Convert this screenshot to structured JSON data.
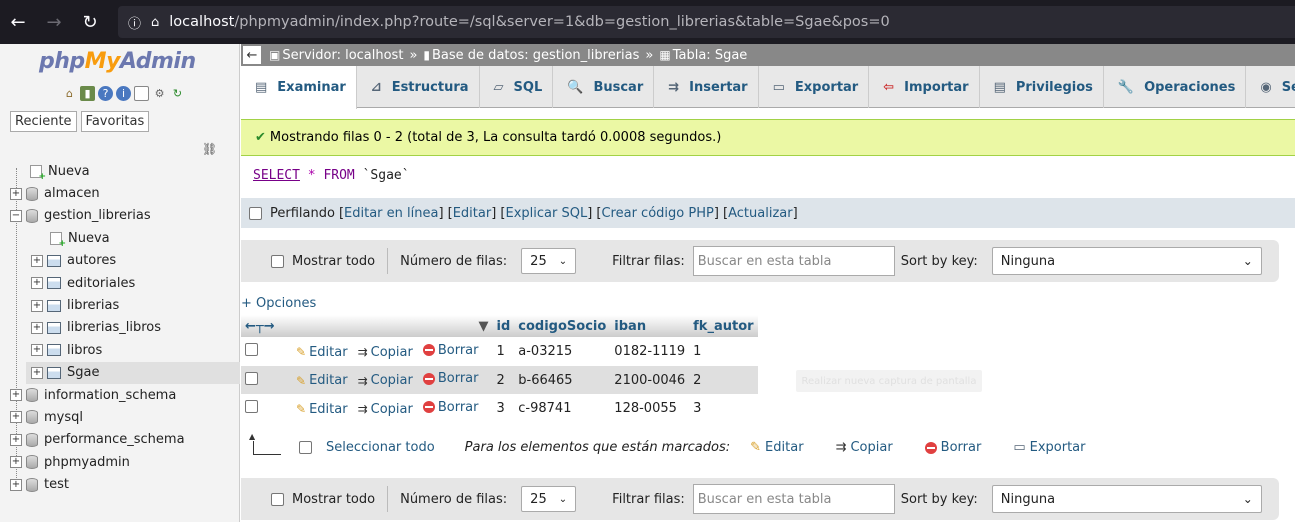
{
  "browser": {
    "url_host": "localhost",
    "url_rest": "/phpmyadmin/index.php?route=/sql&server=1&db=gestion_librerias&table=Sgae&pos=0"
  },
  "sidebar": {
    "logo_php": "php",
    "logo_my": "My",
    "logo_admin": "Admin",
    "tab_recent": "Reciente",
    "tab_favorites": "Favoritas",
    "tree": {
      "new": "Nueva",
      "db_almacen": "almacen",
      "db_gestion": "gestion_librerias",
      "gestion_new": "Nueva",
      "t_autores": "autores",
      "t_editoriales": "editoriales",
      "t_librerias": "librerias",
      "t_librerias_libros": "librerias_libros",
      "t_libros": "libros",
      "t_sgae": "Sgae",
      "db_information": "information_schema",
      "db_mysql": "mysql",
      "db_performance": "performance_schema",
      "db_phpmyadmin": "phpmyadmin",
      "db_test": "test"
    }
  },
  "breadcrumb": {
    "server": "Servidor: localhost",
    "database": "Base de datos: gestion_librerias",
    "table": "Tabla: Sgae"
  },
  "tabs": {
    "browse": "Examinar",
    "structure": "Estructura",
    "sql": "SQL",
    "search": "Buscar",
    "insert": "Insertar",
    "export": "Exportar",
    "import": "Importar",
    "privileges": "Privilegios",
    "operations": "Operaciones",
    "tracking": "Seguimien"
  },
  "message": "Mostrando filas 0 - 2 (total de 3, La consulta tardó 0.0008 segundos.)",
  "query": {
    "select": "SELECT",
    "star": "*",
    "from": "FROM",
    "table": "`Sgae`"
  },
  "profiling": {
    "label": "Perfilando",
    "edit_inline": "Editar en línea",
    "edit": "Editar",
    "explain": "Explicar SQL",
    "php": "Crear código PHP",
    "refresh": "Actualizar"
  },
  "nav": {
    "show_all": "Mostrar todo",
    "rows_label": "Número de filas:",
    "rows_value": "25",
    "filter_label": "Filtrar filas:",
    "filter_placeholder": "Buscar en esta tabla",
    "sort_label": "Sort by key:",
    "sort_value": "Ninguna"
  },
  "options_link": "+ Opciones",
  "table": {
    "columns": [
      "id",
      "codigoSocio",
      "iban",
      "fk_autor"
    ],
    "action_edit": "Editar",
    "action_copy": "Copiar",
    "action_delete": "Borrar",
    "rows": [
      {
        "id": "1",
        "codigoSocio": "a-03215",
        "iban": "0182-1119",
        "fk_autor": "1"
      },
      {
        "id": "2",
        "codigoSocio": "b-66465",
        "iban": "2100-0046",
        "fk_autor": "2"
      },
      {
        "id": "3",
        "codigoSocio": "c-98741",
        "iban": "128-0055",
        "fk_autor": "3"
      }
    ]
  },
  "tooltip": "Realizar nueva captura de pantalla",
  "bulk": {
    "select_all": "Seleccionar todo",
    "with_selected": "Para los elementos que están marcados:",
    "edit": "Editar",
    "copy": "Copiar",
    "delete": "Borrar",
    "export": "Exportar"
  }
}
